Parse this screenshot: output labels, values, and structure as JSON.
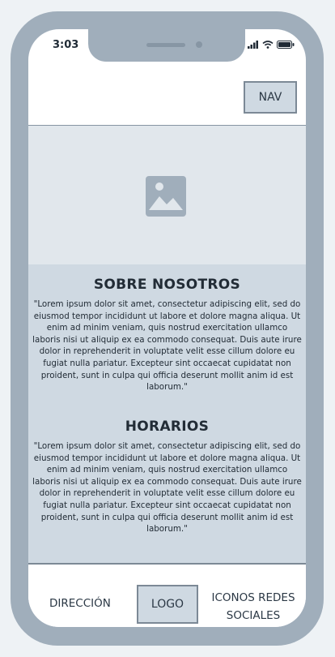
{
  "status_bar": {
    "time": "3:03"
  },
  "header": {
    "nav_label": "NAV"
  },
  "hero": {
    "icon": "image-placeholder-icon"
  },
  "sections": [
    {
      "title": "SOBRE NOSOTROS",
      "text": "\"Lorem ipsum dolor sit amet, consectetur adipiscing elit, sed do eiusmod tempor incididunt ut labore et dolore magna aliqua. Ut enim ad minim veniam, quis nostrud exercitation ullamco laboris nisi ut aliquip ex ea commodo consequat. Duis aute irure dolor in reprehenderit in voluptate velit esse cillum dolore eu fugiat nulla pariatur. Excepteur sint occaecat cupidatat non proident, sunt in culpa qui officia deserunt mollit anim id est laborum.\""
    },
    {
      "title": "HORARIOS",
      "text": "\"Lorem ipsum dolor sit amet, consectetur adipiscing elit, sed do eiusmod tempor incididunt ut labore et dolore magna aliqua. Ut enim ad minim veniam, quis nostrud exercitation ullamco laboris nisi ut aliquip ex ea commodo consequat. Duis aute irure dolor in reprehenderit in voluptate velit esse cillum dolore eu fugiat nulla pariatur. Excepteur sint occaecat cupidatat non proident, sunt in culpa qui officia deserunt mollit anim id est laborum.\""
    }
  ],
  "footer": {
    "address_label": "DIRECCIÓN",
    "logo_label": "LOGO",
    "social_label": "ICONOS REDES SOCIALES"
  },
  "colors": {
    "frame": "#a0aebb",
    "panel": "#cfd9e2",
    "hero_bg": "#e1e7ec",
    "border": "#7c8996"
  }
}
